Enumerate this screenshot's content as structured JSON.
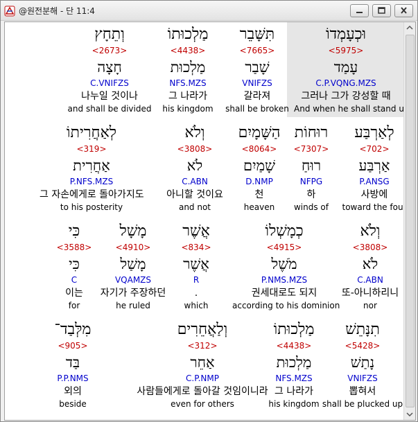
{
  "window": {
    "title": "@원전분해 - 단 11:4",
    "buttons": {
      "minimize": "minimize-icon",
      "maximize": "maximize-icon",
      "close": "close-icon"
    }
  },
  "rows": [
    [
      {
        "hebrew": "וּכְעָמְדוֹ",
        "strong": "<5975>",
        "lemma": "עָמַד",
        "morph": "C.P.VQNG.MZS",
        "korean": "그러나 그가 강성할 때",
        "english": "And when he shall stand up",
        "selected": true
      },
      {
        "hebrew": "תִּשָּׁבֵר",
        "strong": "<7665>",
        "lemma": "שָׁבַר",
        "morph": "VNIFZS",
        "korean": "갈라져",
        "english": "shall be broken"
      },
      {
        "hebrew": "מַלְכוּתוֹ",
        "strong": "<4438>",
        "lemma": "מַלְכוּת",
        "morph": "NFS.MZS",
        "korean": "그 나라가",
        "english": "his kingdom"
      },
      {
        "hebrew": "וְתֵחָץ",
        "strong": "<2673>",
        "lemma": "חָצָה",
        "morph": "C.VNIFZS",
        "korean": "나누일 것이나",
        "english": "and shall be divided"
      }
    ],
    [
      {
        "hebrew": "לְאַרְבַּע",
        "strong": "<702>",
        "lemma": "אַרְבַּע",
        "morph": "P.ANSG",
        "korean": "사방에",
        "english": "toward the four"
      },
      {
        "hebrew": "רוּחוֹת",
        "strong": "<7307>",
        "lemma": "רוּחַ",
        "morph": "NFPG",
        "korean": "하",
        "english": "winds of"
      },
      {
        "hebrew": "הַשָּׁמָיִם",
        "strong": "<8064>",
        "lemma": "שָׁמַיִם",
        "morph": "D.NMP",
        "korean": "천",
        "english": "heaven"
      },
      {
        "hebrew": "וְלֹא",
        "strong": "<3808>",
        "lemma": "לֹא",
        "morph": "C.ABN",
        "korean": "아니할 것이요",
        "english": "and not"
      },
      {
        "hebrew": "לְאַחֲרִיתוֹ",
        "strong": "<319>",
        "lemma": "אַחֲרִית",
        "morph": "P.NFS.MZS",
        "korean": "그 자손에게로 돌아가지도",
        "english": "to his posterity"
      }
    ],
    [
      {
        "hebrew": "וְלֹא",
        "strong": "<3808>",
        "lemma": "לֹא",
        "morph": "C.ABN",
        "korean": "또-아니하리니",
        "english": "nor"
      },
      {
        "hebrew": "כְמָשְׁלוֹ",
        "strong": "<4915>",
        "lemma": "מֹשֶׁל",
        "morph": "P.NMS.MZS",
        "korean": "권세대로도 되지",
        "english": "according to his dominion"
      },
      {
        "hebrew": "אֲשֶׁר",
        "strong": "<834>",
        "lemma": "אֲשֶׁר",
        "morph": "R",
        "korean": ".",
        "english": "which"
      },
      {
        "hebrew": "מָשָׁל",
        "strong": "<4910>",
        "lemma": "מָשַׁל",
        "morph": "VQAMZS",
        "korean": "자기가 주장하던",
        "english": "he ruled"
      },
      {
        "hebrew": "כִּי",
        "strong": "<3588>",
        "lemma": "כִּי",
        "morph": "C",
        "korean": "이는",
        "english": "for"
      }
    ],
    [
      {
        "hebrew": "תִנָּתֵשׁ",
        "strong": "<5428>",
        "lemma": "נָתַשׁ",
        "morph": "VNIFZS",
        "korean": "뽑혀서",
        "english": "shall be plucked up"
      },
      {
        "hebrew": "מַלְכוּתוֹ",
        "strong": "<4438>",
        "lemma": "מַלְכוּת",
        "morph": "NFS.MZS",
        "korean": "그 나라가",
        "english": "his kingdom"
      },
      {
        "hebrew": "וְלַאֲחֵרִים",
        "strong": "<312>",
        "lemma": "אַחֵר",
        "morph": "C.P.NMP",
        "korean": "사람들에게로 돌아갈 것임이니라",
        "english": "even for others"
      },
      {
        "hebrew": "מִלְּבַד־",
        "strong": "<905>",
        "lemma": "בַּד",
        "morph": "P.P.NMS",
        "korean": "외의",
        "english": "beside"
      }
    ]
  ]
}
